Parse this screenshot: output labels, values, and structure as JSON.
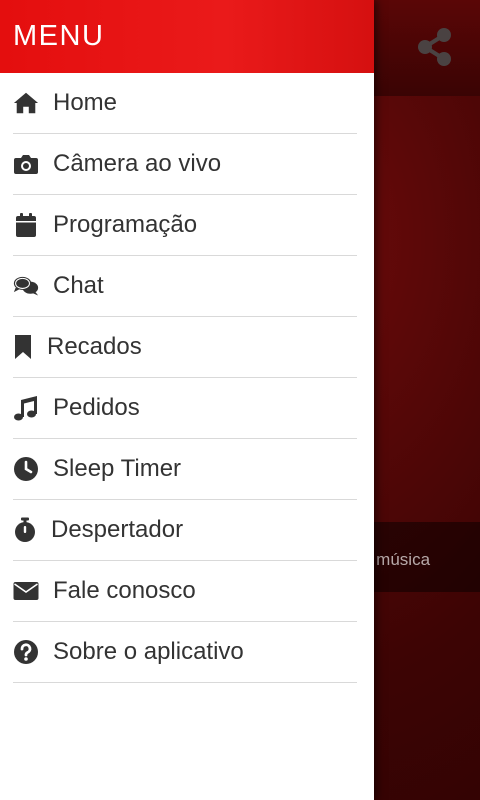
{
  "drawer": {
    "title": "MENU",
    "items": [
      {
        "label": "Home",
        "icon": "home-icon"
      },
      {
        "label": "Câmera ao vivo",
        "icon": "camera-icon"
      },
      {
        "label": "Programação",
        "icon": "calendar-icon"
      },
      {
        "label": "Chat",
        "icon": "chat-icon"
      },
      {
        "label": "Recados",
        "icon": "bookmark-icon"
      },
      {
        "label": "Pedidos",
        "icon": "music-icon"
      },
      {
        "label": "Sleep Timer",
        "icon": "clock-icon"
      },
      {
        "label": "Despertador",
        "icon": "stopwatch-icon"
      },
      {
        "label": "Fale conosco",
        "icon": "envelope-icon"
      },
      {
        "label": "Sobre o aplicativo",
        "icon": "question-icon"
      }
    ]
  },
  "background": {
    "now_playing_text": "a música",
    "share_icon": "share-icon"
  },
  "colors": {
    "accent": "#e40e0e",
    "icon": "#333333",
    "text": "#333333",
    "background": "#3a0303"
  }
}
